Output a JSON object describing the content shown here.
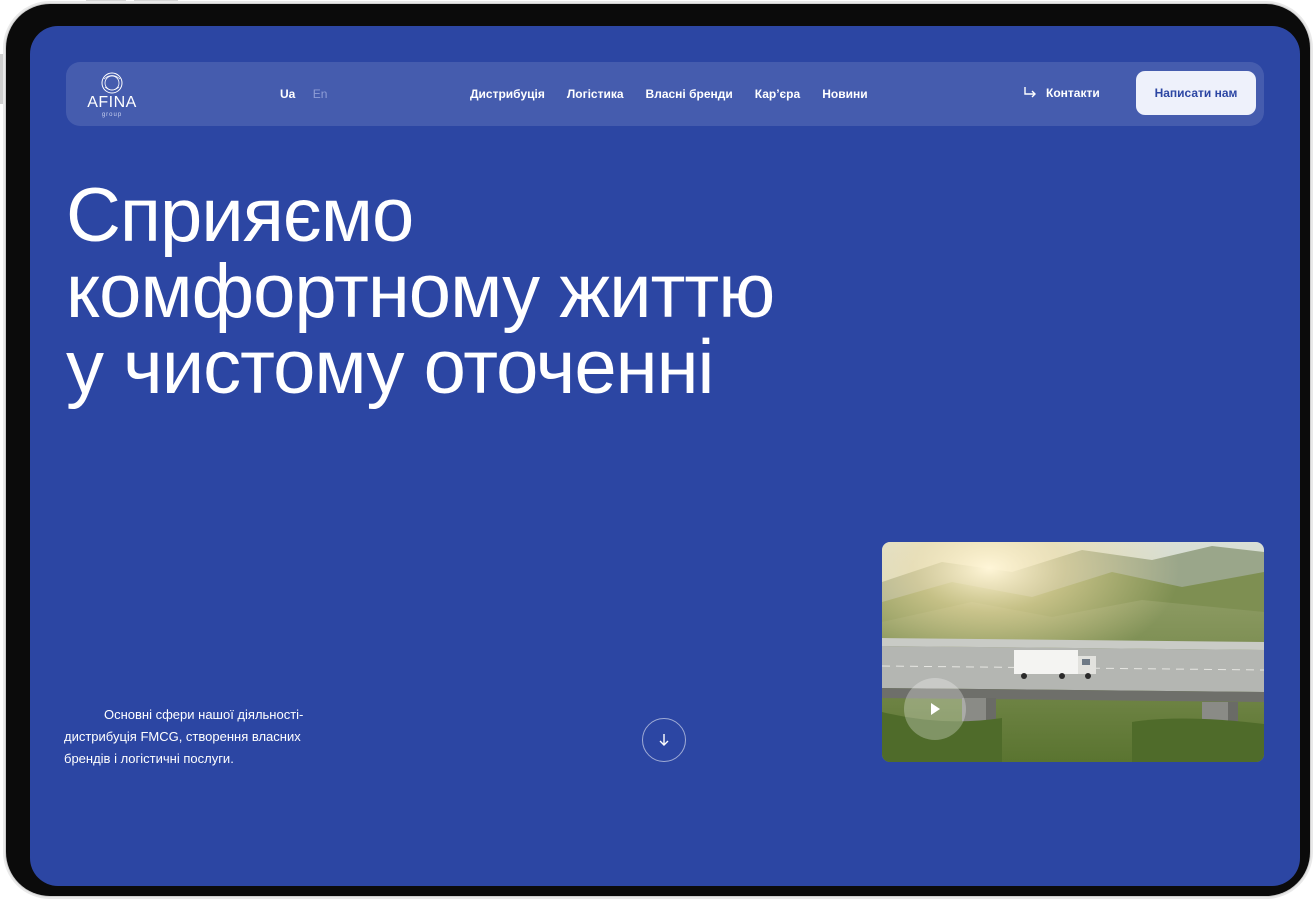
{
  "brand": {
    "name": "AFINA",
    "tagline": "group"
  },
  "languages": {
    "active": "Ua",
    "inactive": "En"
  },
  "nav": {
    "items": [
      {
        "label": "Дистрибуція"
      },
      {
        "label": "Логістика"
      },
      {
        "label": "Власні бренди"
      },
      {
        "label": "Кар’єра"
      },
      {
        "label": "Новини"
      }
    ],
    "contacts_label": "Контакти",
    "cta_label": "Написати нам"
  },
  "hero": {
    "headline_lines": [
      "Сприяємо",
      "комфортному життю",
      "у чистому оточенні"
    ],
    "description": "Основні сфери нашої діяльності- дистрибуція FMCG, створення власних брендів і логістичні послуги."
  },
  "icons": {
    "contacts": "arrow-turn-right-icon",
    "scroll": "arrow-down-icon",
    "play": "play-icon"
  },
  "colors": {
    "background": "#2c46a3",
    "cta_background": "#eef1fb",
    "cta_text": "#2c46a3"
  }
}
